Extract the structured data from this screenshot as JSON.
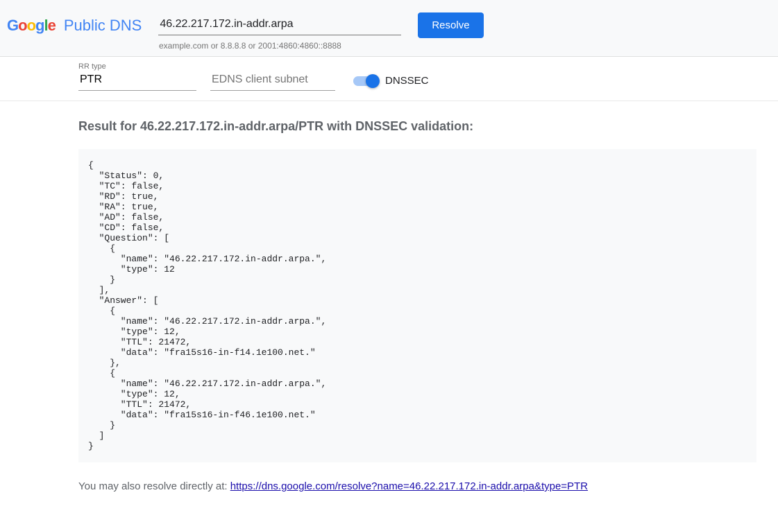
{
  "header": {
    "product_name": "Public DNS",
    "domain_value": "46.22.217.172.in-addr.arpa",
    "hint": "example.com or 8.8.8.8 or 2001:4860:4860::8888",
    "resolve_label": "Resolve"
  },
  "controls": {
    "rr_label": "RR type",
    "rr_value": "PTR",
    "edns_placeholder": "EDNS client subnet",
    "dnssec_label": "DNSSEC"
  },
  "result": {
    "title": "Result for 46.22.217.172.in-addr.arpa/PTR with DNSSEC validation:",
    "json_text": "{\n  \"Status\": 0,\n  \"TC\": false,\n  \"RD\": true,\n  \"RA\": true,\n  \"AD\": false,\n  \"CD\": false,\n  \"Question\": [\n    {\n      \"name\": \"46.22.217.172.in-addr.arpa.\",\n      \"type\": 12\n    }\n  ],\n  \"Answer\": [\n    {\n      \"name\": \"46.22.217.172.in-addr.arpa.\",\n      \"type\": 12,\n      \"TTL\": 21472,\n      \"data\": \"fra15s16-in-f14.1e100.net.\"\n    },\n    {\n      \"name\": \"46.22.217.172.in-addr.arpa.\",\n      \"type\": 12,\n      \"TTL\": 21472,\n      \"data\": \"fra15s16-in-f46.1e100.net.\"\n    }\n  ]\n}"
  },
  "footer": {
    "prefix": "You may also resolve directly at: ",
    "link_text": "https://dns.google.com/resolve?name=46.22.217.172.in-addr.arpa&type=PTR"
  }
}
